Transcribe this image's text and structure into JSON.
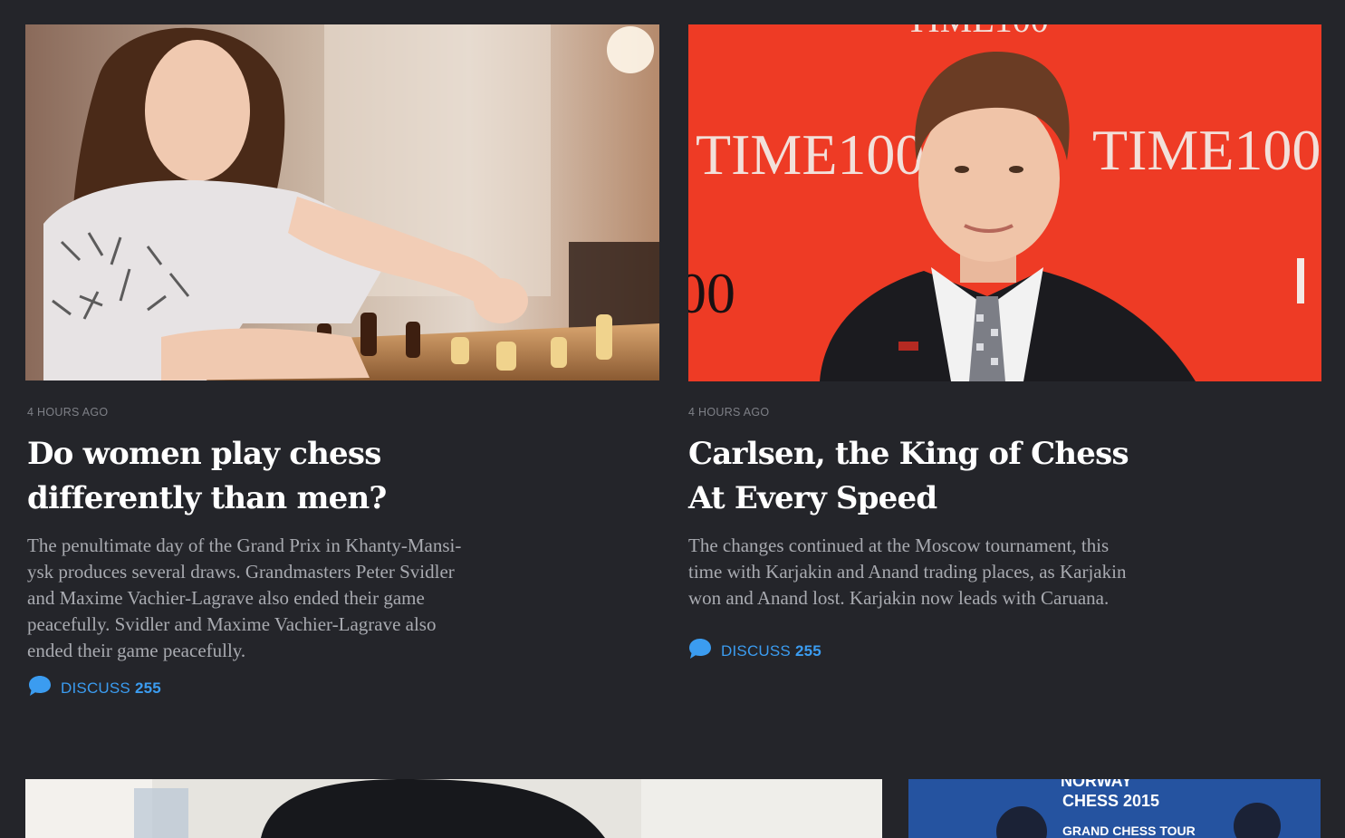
{
  "articles": [
    {
      "time_ago": "4 HOURS AGO",
      "title_lines": [
        "Do women play chess",
        "differently than men?"
      ],
      "summary_lines": [
        "The penultimate day of the Grand Prix in Khanty-Mansi-",
        "ysk produces several draws. Grandmasters Peter Svidler",
        "and Maxime Vachier-Lagrave also ended their game",
        "peacefully. Svidler and Maxime Vachier-Lagrave also",
        "ended their game peacefully."
      ],
      "discuss_label": "DISCUSS",
      "discuss_count": "255",
      "image": "woman-playing-chess-photo"
    },
    {
      "time_ago": "4 HOURS AGO",
      "title_lines": [
        "Carlsen, the King of Chess",
        "At Every Speed"
      ],
      "summary_lines": [
        "The changes continued at the Moscow tournament, this",
        "time with Karjakin and Anand trading places, as Karjakin",
        "won and Anand lost. Karjakin now leads with Caruana."
      ],
      "discuss_label": "DISCUSS",
      "discuss_count": "255",
      "image": "carlsen-time100-photo",
      "image_text": [
        "TIME100",
        "TIME100",
        "TIME100"
      ]
    }
  ],
  "lower_cards": [
    {
      "image": "man-portrait-photo"
    },
    {
      "image": "norway-chess-photo",
      "image_text": [
        "NORWAY",
        "CHESS 2015",
        "GRAND CHESS TOUR"
      ]
    }
  ],
  "colors": {
    "background": "#24252a",
    "accent": "#3b9cf0",
    "title": "#ffffff",
    "body_text": "#a8aab0",
    "meta": "#7e8087"
  },
  "icons": {
    "discuss": "speech-bubble-icon"
  }
}
